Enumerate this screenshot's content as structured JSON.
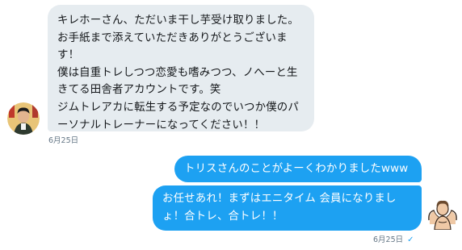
{
  "messages": {
    "incoming": {
      "lines": [
        "キレホーさん、ただいま干し芋受け取りました。",
        "お手紙まで添えていただきありがとうございま",
        "す！",
        "僕は自重トレしつつ恋愛も嗜みつつ、ノへーと生",
        "きてる田舎者アカウントです。笑",
        "ジムトレアカに転生する予定なのでいつか僕のパ",
        "ーソナルトレーナーになってください！！"
      ],
      "timestamp": "6月25日",
      "avatar_icon": "user-avatar-icon"
    },
    "outgoing": [
      {
        "lines": [
          "トリスさんのことがよーくわかりましたwww"
        ]
      },
      {
        "lines": [
          "お任せあれ！まずはエニタイム 会員になりまし",
          "ょ！合トレ、合トレ！！"
        ]
      }
    ],
    "outgoing_timestamp": "6月25日",
    "read_icon": "checkmark-icon",
    "outgoing_avatar_icon": "muscle-avatar-icon"
  },
  "colors": {
    "incoming_bubble": "#e6ecf0",
    "outgoing_bubble": "#1da1f2",
    "timestamp": "#657786"
  }
}
